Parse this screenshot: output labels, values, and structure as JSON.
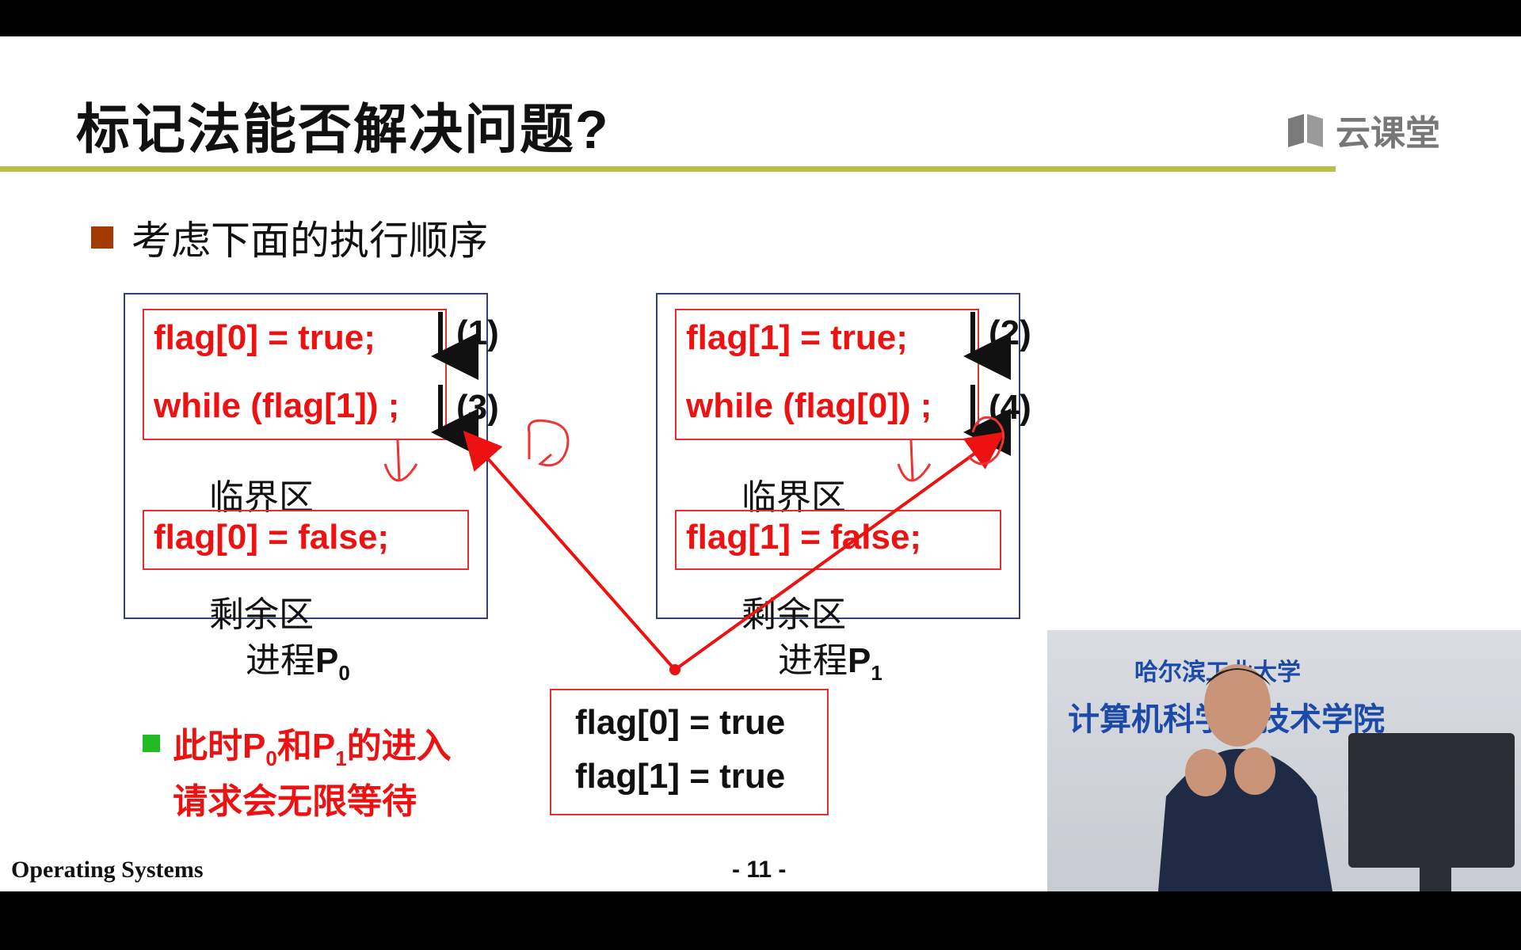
{
  "slide": {
    "title": "标记法能否解决问题?",
    "logo_text": "云课堂",
    "bullet": "考虑下面的执行顺序",
    "footer_left": "Operating Systems",
    "page": "- 11 -"
  },
  "process0": {
    "line1": "flag[0] = true;",
    "line2": "while (flag[1]) ;",
    "critical": "临界区",
    "exit": "flag[0] = false;",
    "remainder": "剩余区",
    "label_prefix": "进程",
    "label_p": "P",
    "label_sub": "0",
    "step1": "(1)",
    "step2": "(3)"
  },
  "process1": {
    "line1": "flag[1] = true;",
    "line2": "while (flag[0]) ;",
    "critical": "临界区",
    "exit": "flag[1] = false;",
    "remainder": "剩余区",
    "label_prefix": "进程",
    "label_p": "P",
    "label_sub": "1",
    "step1": "(2)",
    "step2": "(4)"
  },
  "state": {
    "line1": "flag[0] = true",
    "line2": "flag[1] = true"
  },
  "note": {
    "a": "此时",
    "p0": "P",
    "sub0": "0",
    "and": "和",
    "p1": "P",
    "sub1": "1",
    "b": "的进入",
    "line2": "请求会无限等待"
  },
  "video": {
    "banner_top": "哈尔滨工业大学",
    "banner_main": "计算机科学与技术学院"
  },
  "colors": {
    "accent_red": "#e11111",
    "rule_olive": "#b9bf4a",
    "bullet_brown": "#a33a00",
    "note_green": "#22bb22"
  }
}
